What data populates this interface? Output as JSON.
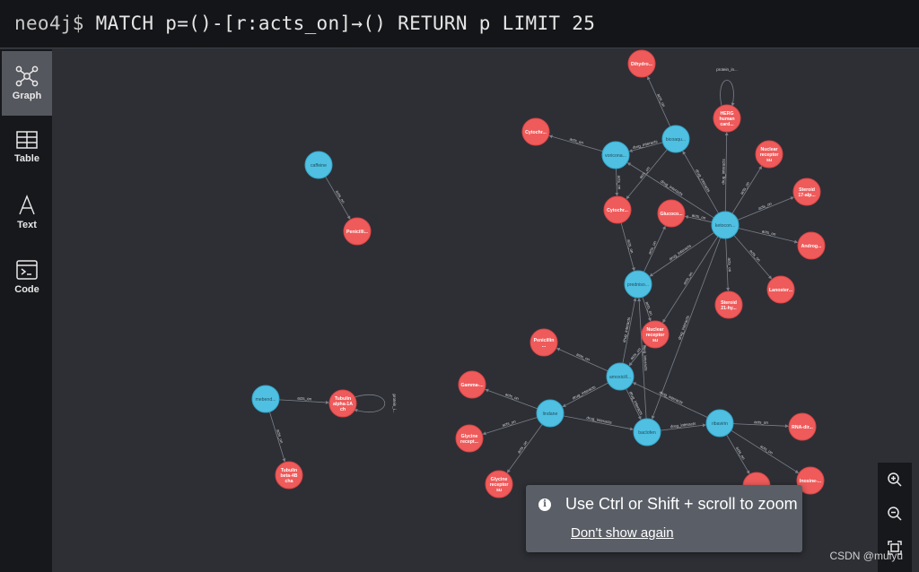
{
  "query": {
    "prompt": "neo4j$",
    "text": "MATCH p=()-[r:acts_on]→() RETURN p LIMIT 25"
  },
  "sidebar": {
    "items": [
      {
        "label": "Graph"
      },
      {
        "label": "Table"
      },
      {
        "label": "Text"
      },
      {
        "label": "Code"
      }
    ]
  },
  "colors": {
    "compound_node": "#4fc0e2",
    "target_node": "#ef5b5b",
    "background": "#2d2f35"
  },
  "graph": {
    "nodes": [
      {
        "id": "ca",
        "label": [
          "caffeine"
        ],
        "type": "compound"
      },
      {
        "id": "pe1",
        "label": [
          "Penicilli..."
        ],
        "type": "target"
      },
      {
        "id": "mb",
        "label": [
          "mebend..."
        ],
        "type": "compound"
      },
      {
        "id": "ta",
        "label": [
          "Tubulin",
          "alpha-1A",
          "ch"
        ],
        "type": "target"
      },
      {
        "id": "tb",
        "label": [
          "Tubulin",
          "beta-4B",
          "cha"
        ],
        "type": "target"
      },
      {
        "id": "di",
        "label": [
          "Dihydro..."
        ],
        "type": "target"
      },
      {
        "id": "he",
        "label": [
          "HERG",
          "human",
          "card..."
        ],
        "type": "target"
      },
      {
        "id": "cy1",
        "label": [
          "Cytochr..."
        ],
        "type": "target"
      },
      {
        "id": "vo",
        "label": [
          "voricona..."
        ],
        "type": "compound"
      },
      {
        "id": "bu",
        "label": [
          "bicoaqu..."
        ],
        "type": "compound"
      },
      {
        "id": "nr1",
        "label": [
          "Nuclear",
          "receptor",
          "su"
        ],
        "type": "target"
      },
      {
        "id": "st17",
        "label": [
          "Steroid",
          "17-alp..."
        ],
        "type": "target"
      },
      {
        "id": "cy2",
        "label": [
          "Cytochr..."
        ],
        "type": "target"
      },
      {
        "id": "gl",
        "label": [
          "Glucoco..."
        ],
        "type": "target"
      },
      {
        "id": "ke",
        "label": [
          "ketocon..."
        ],
        "type": "compound"
      },
      {
        "id": "an",
        "label": [
          "Androg..."
        ],
        "type": "target"
      },
      {
        "id": "pr",
        "label": [
          "predniso..."
        ],
        "type": "compound"
      },
      {
        "id": "la",
        "label": [
          "Lanoster..."
        ],
        "type": "target"
      },
      {
        "id": "st21",
        "label": [
          "Steroid",
          "21-hy..."
        ],
        "type": "target"
      },
      {
        "id": "nr2",
        "label": [
          "Nuclear",
          "receptor",
          "su"
        ],
        "type": "target"
      },
      {
        "id": "pe2",
        "label": [
          "Penicillin",
          "..."
        ],
        "type": "target"
      },
      {
        "id": "am",
        "label": [
          "amoxicill..."
        ],
        "type": "compound"
      },
      {
        "id": "ga",
        "label": [
          "Gamma-..."
        ],
        "type": "target"
      },
      {
        "id": "li",
        "label": [
          "lindane"
        ],
        "type": "compound"
      },
      {
        "id": "gr1",
        "label": [
          "Glycine",
          "recept..."
        ],
        "type": "target"
      },
      {
        "id": "gr2",
        "label": [
          "Glycine",
          "receptor",
          "su"
        ],
        "type": "target"
      },
      {
        "id": "ba",
        "label": [
          "baclofen"
        ],
        "type": "compound"
      },
      {
        "id": "ri",
        "label": [
          "ribavirin"
        ],
        "type": "compound"
      },
      {
        "id": "rna",
        "label": [
          "RNA-dir..."
        ],
        "type": "target"
      },
      {
        "id": "ino",
        "label": [
          "Inosine-..."
        ],
        "type": "target"
      },
      {
        "id": "x1",
        "label": [
          ""
        ],
        "type": "target"
      }
    ],
    "edge_labels": [
      "acts_on",
      "drug_interacts",
      "protein_in...",
      "protein_i..."
    ]
  },
  "zoom_controls": [
    {
      "icon": "zoom-in-icon"
    },
    {
      "icon": "zoom-out-icon"
    },
    {
      "icon": "fit-icon"
    }
  ],
  "toast": {
    "message": "Use Ctrl or Shift + scroll to zoom",
    "dismiss": "Don't show again"
  },
  "watermark": "CSDN @muiyu"
}
